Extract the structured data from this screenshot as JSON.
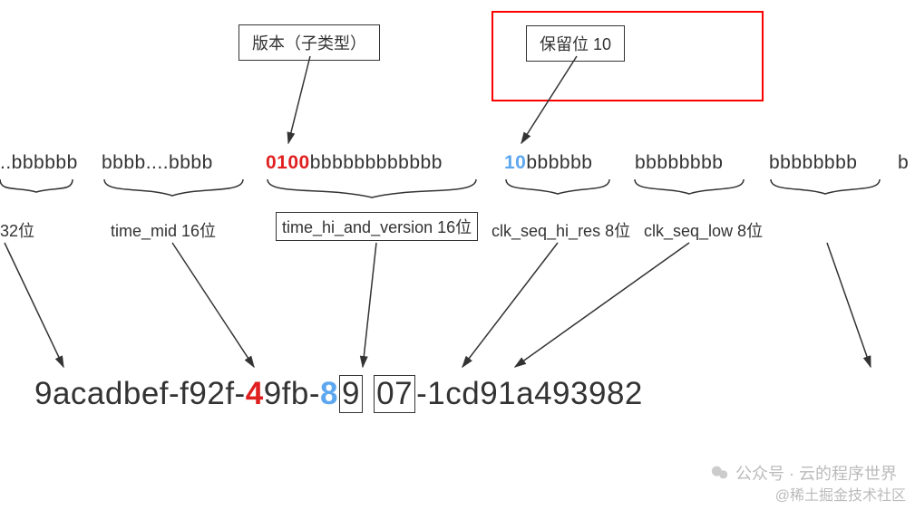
{
  "annotations": {
    "version_box": "版本（子类型）",
    "reserved_box": "保留位 10"
  },
  "bits_row": {
    "seg1": "..bbbbbb",
    "seg2": "bbbb....bbbb",
    "seg3_prefix": "0100",
    "seg3_rest": "bbbbbbbbbbbb",
    "seg4_prefix": "10",
    "seg4_rest": "bbbbbb",
    "seg5": "bbbbbbbb",
    "seg6": "b"
  },
  "labels": {
    "l1": "32位",
    "l2": "time_mid 16位",
    "l3": "time_hi_and_version 16位",
    "l4": "clk_seq_hi_res 8位",
    "l5": "clk_seq_low 8位"
  },
  "uuid": {
    "p1": "9acadbef-f92f-",
    "p2_red": "4",
    "p3": "9fb-",
    "p4_blue": "8",
    "p5_box1": "9",
    "p6_box2": "07",
    "p7": "-1cd91a493982"
  },
  "watermarks": {
    "w1": "公众号 · 云的程序世界",
    "w2": "@稀土掘金技术社区"
  }
}
